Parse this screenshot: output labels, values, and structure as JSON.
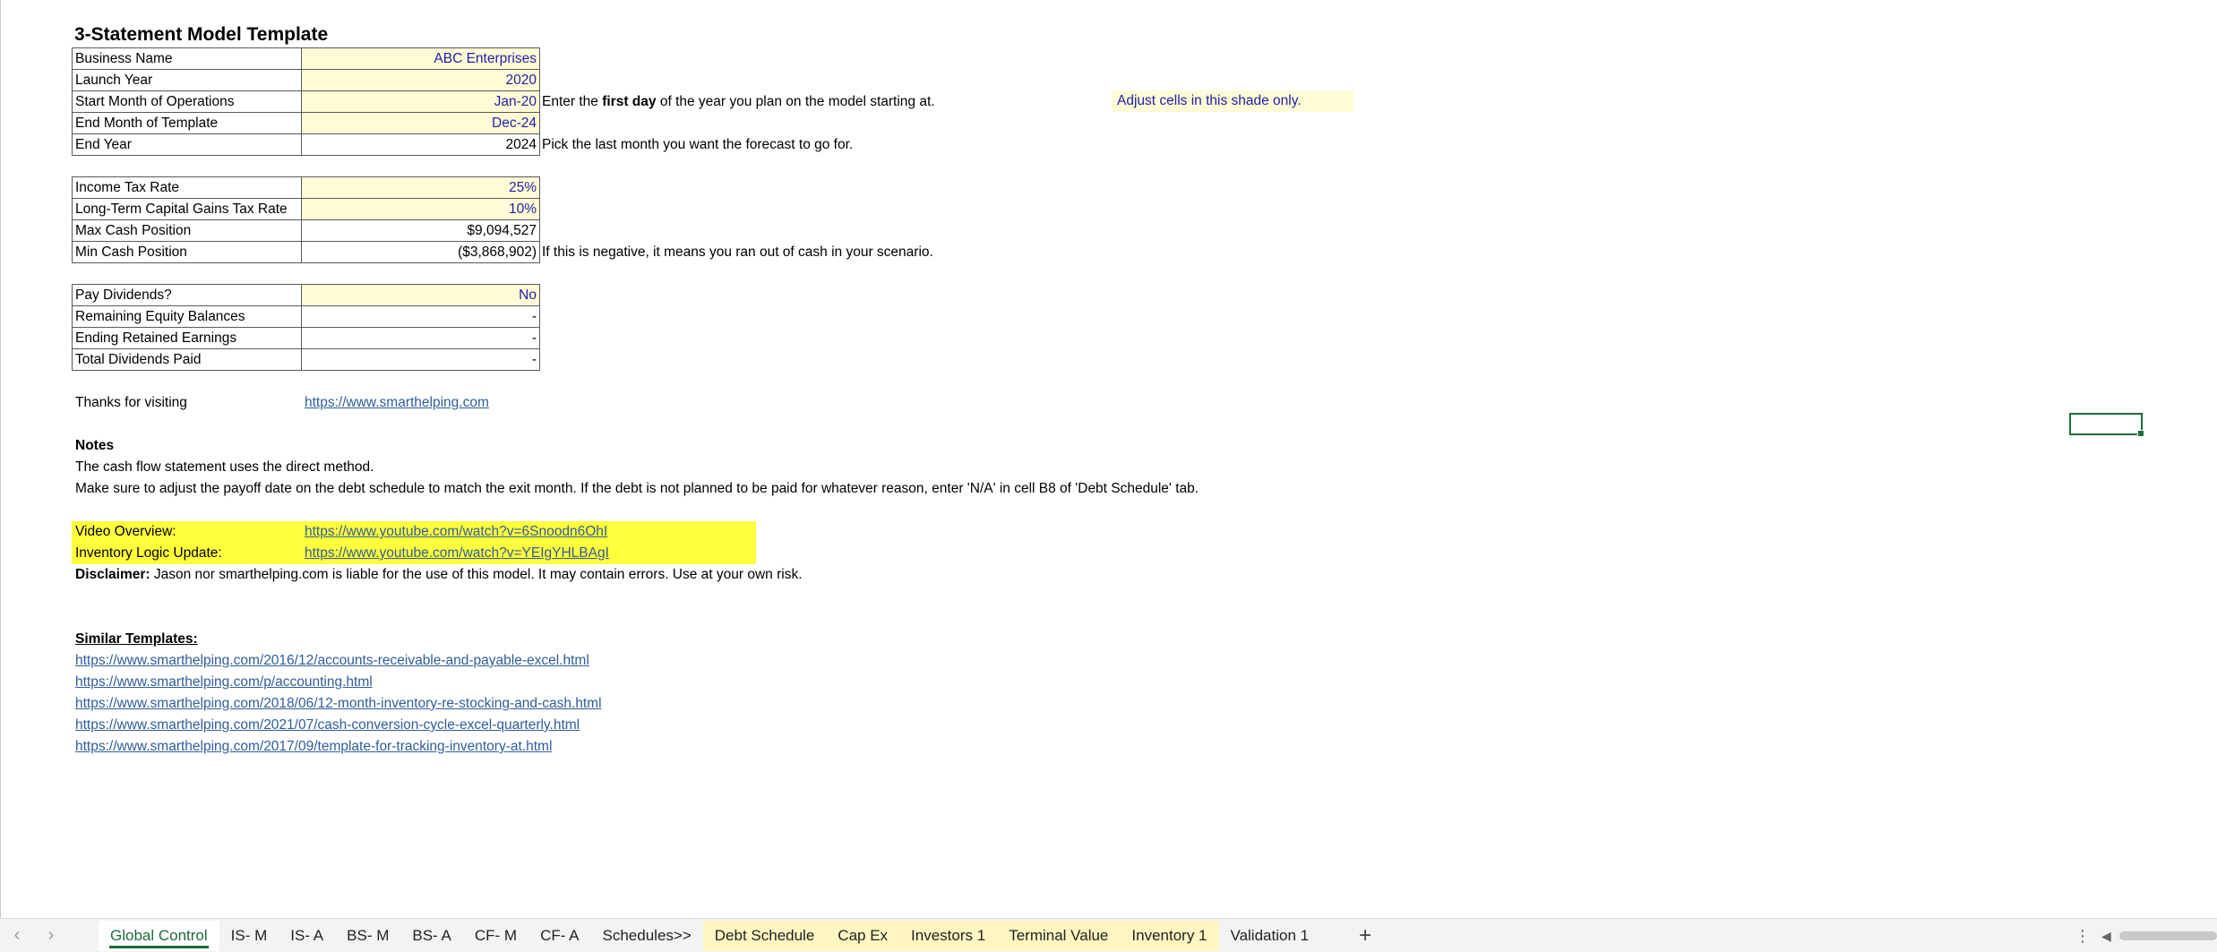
{
  "title": "3-Statement Model Template",
  "table1": [
    {
      "label": "Business Name",
      "value": "ABC Enterprises",
      "input": true,
      "note_parts": []
    },
    {
      "label": "Launch Year",
      "value": "2020",
      "input": true,
      "note_parts": [
        "Enter the ",
        "first day",
        " of the year you plan on the model starting at."
      ]
    },
    {
      "label": "Start Month of Operations",
      "value": "Jan-20",
      "input": true,
      "note_parts": []
    },
    {
      "label": "End Month of Template",
      "value": "Dec-24",
      "input": true,
      "note_parts": [
        "Pick the last month you want the forecast to go for."
      ]
    },
    {
      "label": "End Year",
      "value": "2024",
      "input": false,
      "note_parts": []
    }
  ],
  "shade_note": "Adjust cells in this shade only.",
  "table2": [
    {
      "label": "Income Tax Rate",
      "value": "25%",
      "input": true
    },
    {
      "label": "Long-Term Capital Gains Tax Rate",
      "value": "10%",
      "input": true
    },
    {
      "label": "Max Cash Position",
      "value": "$9,094,527",
      "input": false
    },
    {
      "label": "Min Cash Position",
      "value": "($3,868,902)",
      "input": false
    }
  ],
  "table2_note": "If this is negative, it means you ran out of cash in your scenario.",
  "table3": [
    {
      "label": "Pay Dividends?",
      "value": "No",
      "input": true
    },
    {
      "label": "Remaining Equity Balances",
      "value": "-",
      "input": false
    },
    {
      "label": "Ending Retained Earnings",
      "value": "-",
      "input": false
    },
    {
      "label": "Total Dividends Paid",
      "value": "-",
      "input": false
    }
  ],
  "thanks": {
    "label": "Thanks for visiting",
    "link": "https://www.smarthelping.com"
  },
  "notes": {
    "heading": "Notes",
    "line1": "The cash flow statement uses the direct method.",
    "line2": "Make sure to adjust the payoff date on the debt schedule to match the exit month. If the debt is not planned to be paid for whatever reason, enter 'N/A' in cell B8 of 'Debt Schedule' tab."
  },
  "videos": [
    {
      "label": "Video Overview:",
      "link": "https://www.youtube.com/watch?v=6Snoodn6OhI"
    },
    {
      "label": "Inventory Logic  Update:",
      "link": "https://www.youtube.com/watch?v=YEIgYHLBAgI"
    }
  ],
  "disclaimer": {
    "label": "Disclaimer:",
    "text": " Jason nor smarthelping.com is liable for the use of this model. It may contain errors. Use at your own risk."
  },
  "similar": {
    "heading": "Similar Templates:",
    "links": [
      "https://www.smarthelping.com/2016/12/accounts-receivable-and-payable-excel.html",
      "https://www.smarthelping.com/p/accounting.html",
      "https://www.smarthelping.com/2018/06/12-month-inventory-re-stocking-and-cash.html",
      "https://www.smarthelping.com/2021/07/cash-conversion-cycle-excel-quarterly.html",
      "https://www.smarthelping.com/2017/09/template-for-tracking-inventory-at.html"
    ]
  },
  "tabs": [
    {
      "label": "Global Control",
      "active": true,
      "yellow": false
    },
    {
      "label": "IS- M",
      "active": false,
      "yellow": false
    },
    {
      "label": "IS- A",
      "active": false,
      "yellow": false
    },
    {
      "label": "BS- M",
      "active": false,
      "yellow": false
    },
    {
      "label": "BS- A",
      "active": false,
      "yellow": false
    },
    {
      "label": "CF- M",
      "active": false,
      "yellow": false
    },
    {
      "label": "CF- A",
      "active": false,
      "yellow": false
    },
    {
      "label": "Schedules>>",
      "active": false,
      "yellow": false
    },
    {
      "label": "Debt Schedule",
      "active": false,
      "yellow": true
    },
    {
      "label": "Cap Ex",
      "active": false,
      "yellow": true
    },
    {
      "label": "Investors 1",
      "active": false,
      "yellow": true
    },
    {
      "label": "Terminal Value",
      "active": false,
      "yellow": true
    },
    {
      "label": "Inventory 1",
      "active": false,
      "yellow": true
    },
    {
      "label": "Validation 1",
      "active": false,
      "yellow": false
    }
  ],
  "tabbar": {
    "prev": "‹",
    "next": "›",
    "add": "+",
    "more": "⋮",
    "scroll_left": "◀"
  },
  "colors": {
    "input_fill": "#fffbd6",
    "input_text": "#1f1fa8",
    "highlight": "#ffff3c",
    "active_tab": "#1f6b3b",
    "link": "#2f5d9a"
  }
}
